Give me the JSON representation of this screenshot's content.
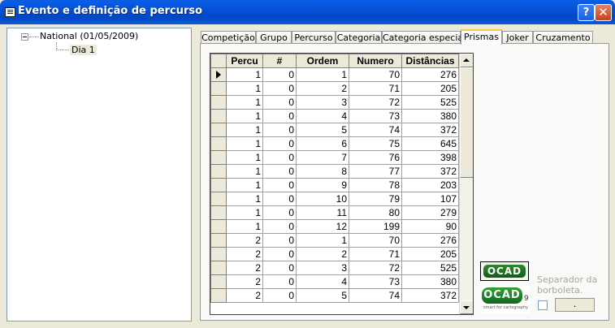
{
  "window": {
    "title": "Evento e definição de percurso",
    "help_label": "?",
    "close_label": "✕",
    "titlebar_color": "#0A58D9"
  },
  "tree": {
    "root_label": "National (01/05/2009)",
    "child_label": "Dia 1"
  },
  "tabs": [
    {
      "label": "Competição"
    },
    {
      "label": "Grupo"
    },
    {
      "label": "Percurso"
    },
    {
      "label": "Categoria"
    },
    {
      "label": "Categoria especial"
    },
    {
      "label": "Prismas",
      "active": true
    },
    {
      "label": "Joker"
    },
    {
      "label": "Cruzamento"
    }
  ],
  "grid": {
    "columns": [
      "Percu",
      "#",
      "Ordem",
      "Numero",
      "Distâncias"
    ],
    "rows": [
      [
        "1",
        "0",
        "1",
        "70",
        "276"
      ],
      [
        "1",
        "0",
        "2",
        "71",
        "205"
      ],
      [
        "1",
        "0",
        "3",
        "72",
        "525"
      ],
      [
        "1",
        "0",
        "4",
        "73",
        "380"
      ],
      [
        "1",
        "0",
        "5",
        "74",
        "372"
      ],
      [
        "1",
        "0",
        "6",
        "75",
        "645"
      ],
      [
        "1",
        "0",
        "7",
        "76",
        "398"
      ],
      [
        "1",
        "0",
        "8",
        "77",
        "372"
      ],
      [
        "1",
        "0",
        "9",
        "78",
        "203"
      ],
      [
        "1",
        "0",
        "10",
        "79",
        "107"
      ],
      [
        "1",
        "0",
        "11",
        "80",
        "279"
      ],
      [
        "1",
        "0",
        "12",
        "199",
        "90"
      ],
      [
        "2",
        "0",
        "1",
        "70",
        "276"
      ],
      [
        "2",
        "0",
        "2",
        "71",
        "205"
      ],
      [
        "2",
        "0",
        "3",
        "72",
        "525"
      ],
      [
        "2",
        "0",
        "4",
        "73",
        "380"
      ],
      [
        "2",
        "0",
        "5",
        "74",
        "372"
      ]
    ]
  },
  "ocad": {
    "button1_label": "OCAD",
    "button2_label": "OCAD",
    "button2_version": "9",
    "button2_tagline": "smart for cartography"
  },
  "separator": {
    "label": "Separador da borboleta.",
    "value": "."
  }
}
